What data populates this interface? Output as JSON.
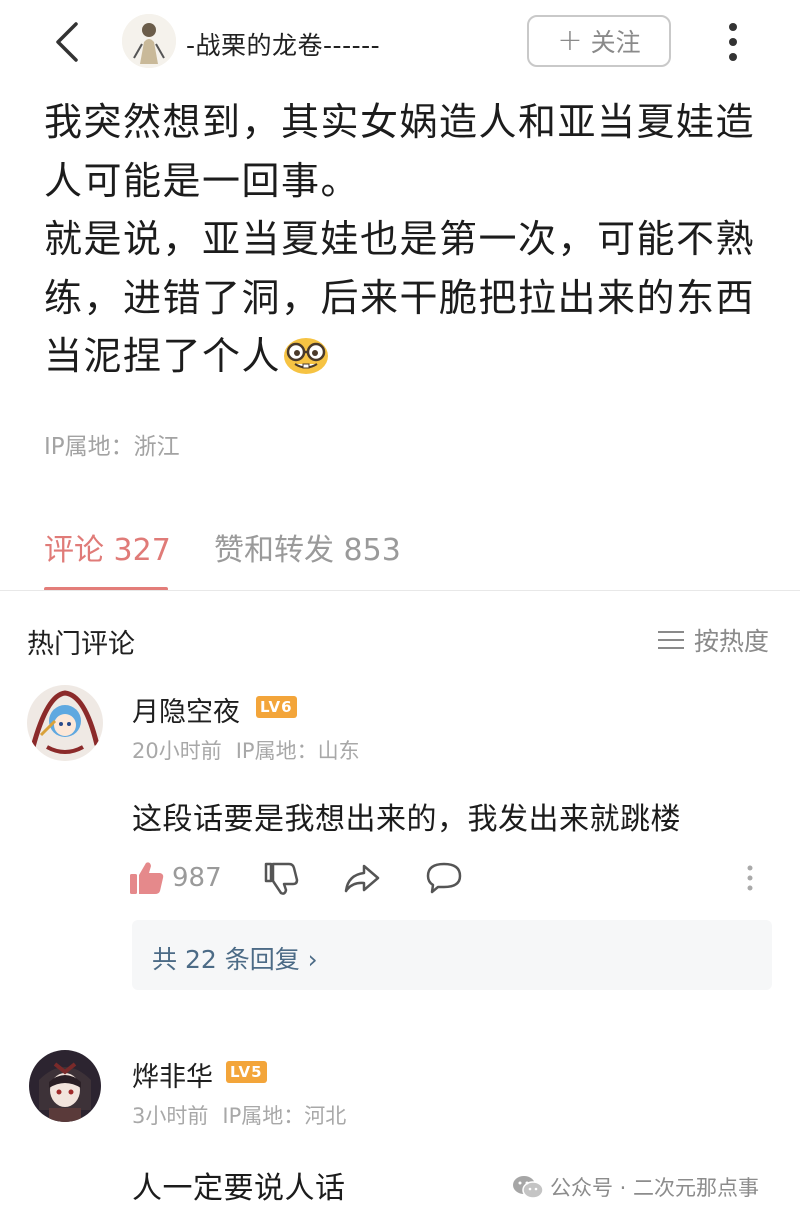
{
  "header": {
    "author_name": "-战栗的龙卷------",
    "follow_label": "关注",
    "follow_plus": "+"
  },
  "post": {
    "paragraphs": [
      "我突然想到，其实女娲造人和亚当夏娃造人可能是一回事。",
      "就是说，亚当夏娃也是第一次，可能不熟练，进错了洞，后来干脆把拉出来的东西当泥捏了个人"
    ],
    "ip_location": "IP属地：浙江"
  },
  "tabs": [
    {
      "label": "评论 327"
    },
    {
      "label": "赞和转发 853"
    }
  ],
  "hot_comments": {
    "title": "热门评论",
    "sort_label": "按热度"
  },
  "comments": [
    {
      "name": "月隐空夜",
      "level": "LV6",
      "time": "20小时前",
      "ip": "IP属地：山东",
      "text": "这段话要是我想出来的，我发出来就跳楼",
      "likes": "987",
      "replies_label": "共 22 条回复 ›"
    },
    {
      "name": "烨非华",
      "level": "LV5",
      "time": "3小时前",
      "ip": "IP属地：河北",
      "text": "人一定要说人话"
    }
  ],
  "watermark": "公众号 · 二次元那点事",
  "colors": {
    "accent": "#e07b78",
    "like_icon": "#e5898b",
    "level_badge": "#f3a53a",
    "reply_link": "#4c6b86"
  }
}
